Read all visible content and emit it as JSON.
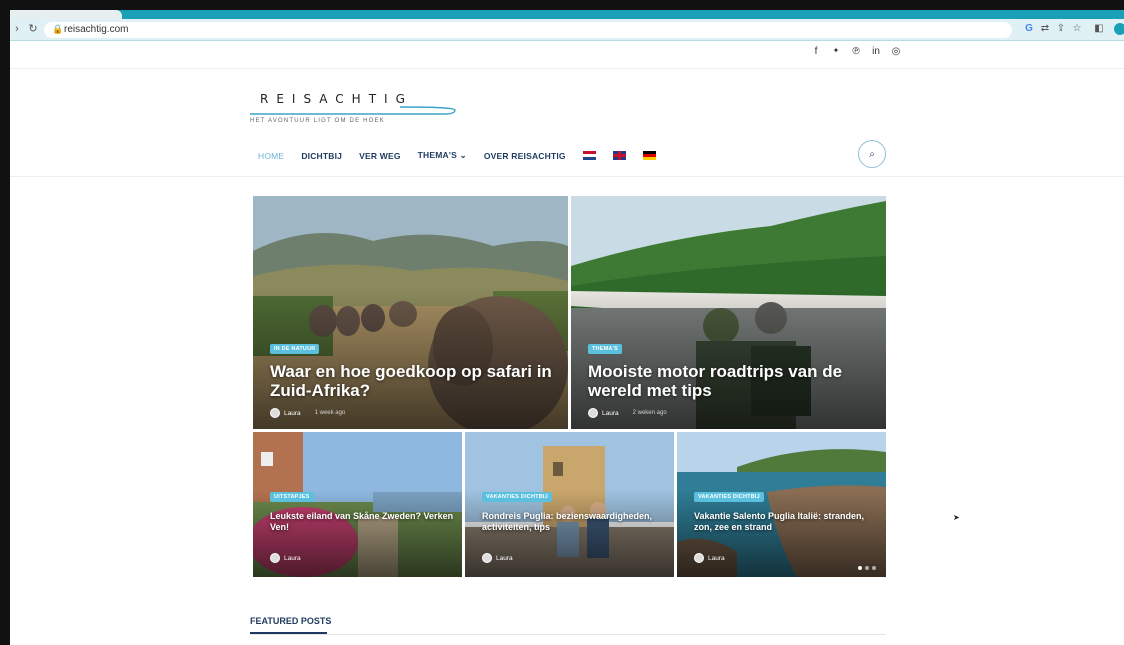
{
  "browser": {
    "url": "reisachtig.com",
    "icons": [
      "back-icon",
      "reload-icon",
      "lock-icon",
      "google-icon",
      "translate-icon",
      "share-icon",
      "star-icon",
      "sidebar-icon",
      "profile-icon"
    ]
  },
  "social": {
    "icons": [
      "facebook-icon",
      "twitter-icon",
      "pinterest-icon",
      "linkedin-icon",
      "instagram-icon"
    ],
    "glyphs": [
      "f",
      "🐦",
      "℗",
      "in",
      "◎"
    ]
  },
  "logo": {
    "title": "REISACHTIG",
    "tagline": "HET AVONTUUR LIGT OM DE HOEK"
  },
  "menu": {
    "items": [
      {
        "label": "HOME",
        "active": true
      },
      {
        "label": "DICHTBIJ"
      },
      {
        "label": "VER WEG"
      },
      {
        "label": "THEMA'S ⌄"
      },
      {
        "label": "OVER REISACHTIG"
      }
    ],
    "flags": [
      "nl-flag",
      "uk-flag",
      "de-flag"
    ]
  },
  "posts": [
    {
      "badge": "IN DE NATUUR",
      "title": "Waar en hoe goedkoop op safari in Zuid-Afrika?",
      "author": "Laura",
      "date": "1 week ago"
    },
    {
      "badge": "THEMA'S",
      "title": "Mooiste motor roadtrips van de wereld met tips",
      "author": "Laura",
      "date": "2 weken ago"
    },
    {
      "badge": "UITSTAPJES",
      "title": "Leukste eiland van Skåne Zweden? Verken Ven!",
      "author": "Laura"
    },
    {
      "badge": "VAKANTIES DICHTBIJ",
      "title": "Rondreis Puglia: bezienswaardigheden, activiteiten, tips",
      "author": "Laura"
    },
    {
      "badge": "VAKANTIES DICHTBIJ",
      "title": "Vakantie Salento Puglia Italië: stranden, zon, zee en strand",
      "author": "Laura"
    }
  ],
  "featured": {
    "label": "FEATURED POSTS"
  },
  "colors": {
    "accent": "#5bc0de",
    "brand": "#1e3a5f",
    "chrome": "#1aa0b6"
  }
}
